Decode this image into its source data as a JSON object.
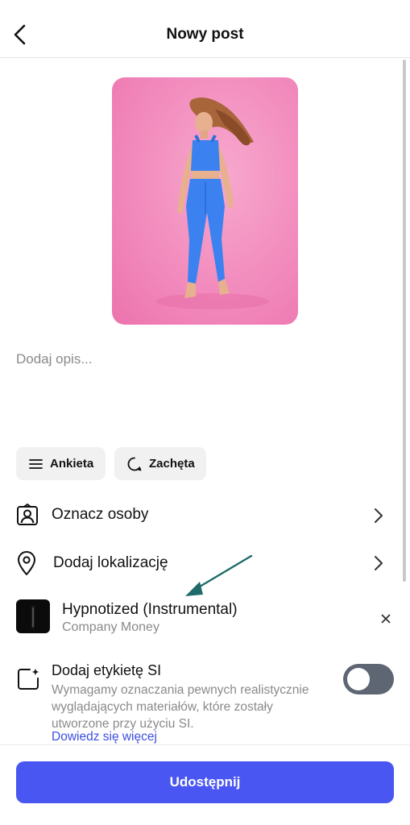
{
  "header": {
    "title": "Nowy post",
    "back_icon": "chevron-left-icon"
  },
  "preview": {
    "alt": "Zdjęcie kobiety w niebieskim stroju sportowym na różowym tle",
    "background_color": "#f28bbd",
    "outfit_color": "#3b82f0"
  },
  "caption": {
    "placeholder": "Dodaj opis..."
  },
  "chips": {
    "poll_label": "Ankieta",
    "poll_icon": "list-icon",
    "prompt_label": "Zachęta",
    "prompt_icon": "speech-bubble-icon"
  },
  "options": {
    "tag_people_label": "Oznacz osoby",
    "tag_people_icon": "person-tag-icon",
    "location_label": "Dodaj lokalizację",
    "location_icon": "map-pin-icon",
    "chevron_icon": "chevron-right-icon"
  },
  "music": {
    "title": "Hypnotized (Instrumental)",
    "artist": "Company Money",
    "remove_icon": "close-icon"
  },
  "ai_label": {
    "title": "Dodaj etykietę SI",
    "description": "Wymagamy oznaczania pewnych realistycznie wyglądających materiałów, które zostały utworzone przy użyciu SI.",
    "link": "Dowiedz się więcej",
    "icon": "ai-sparkle-square-icon",
    "toggle_on": false
  },
  "footer": {
    "share_label": "Udostępnij"
  },
  "colors": {
    "accent": "#4a56f2",
    "link": "#3d4ee0",
    "annotation_arrow": "#1f6b6a",
    "toggle_off": "#5f6673"
  }
}
